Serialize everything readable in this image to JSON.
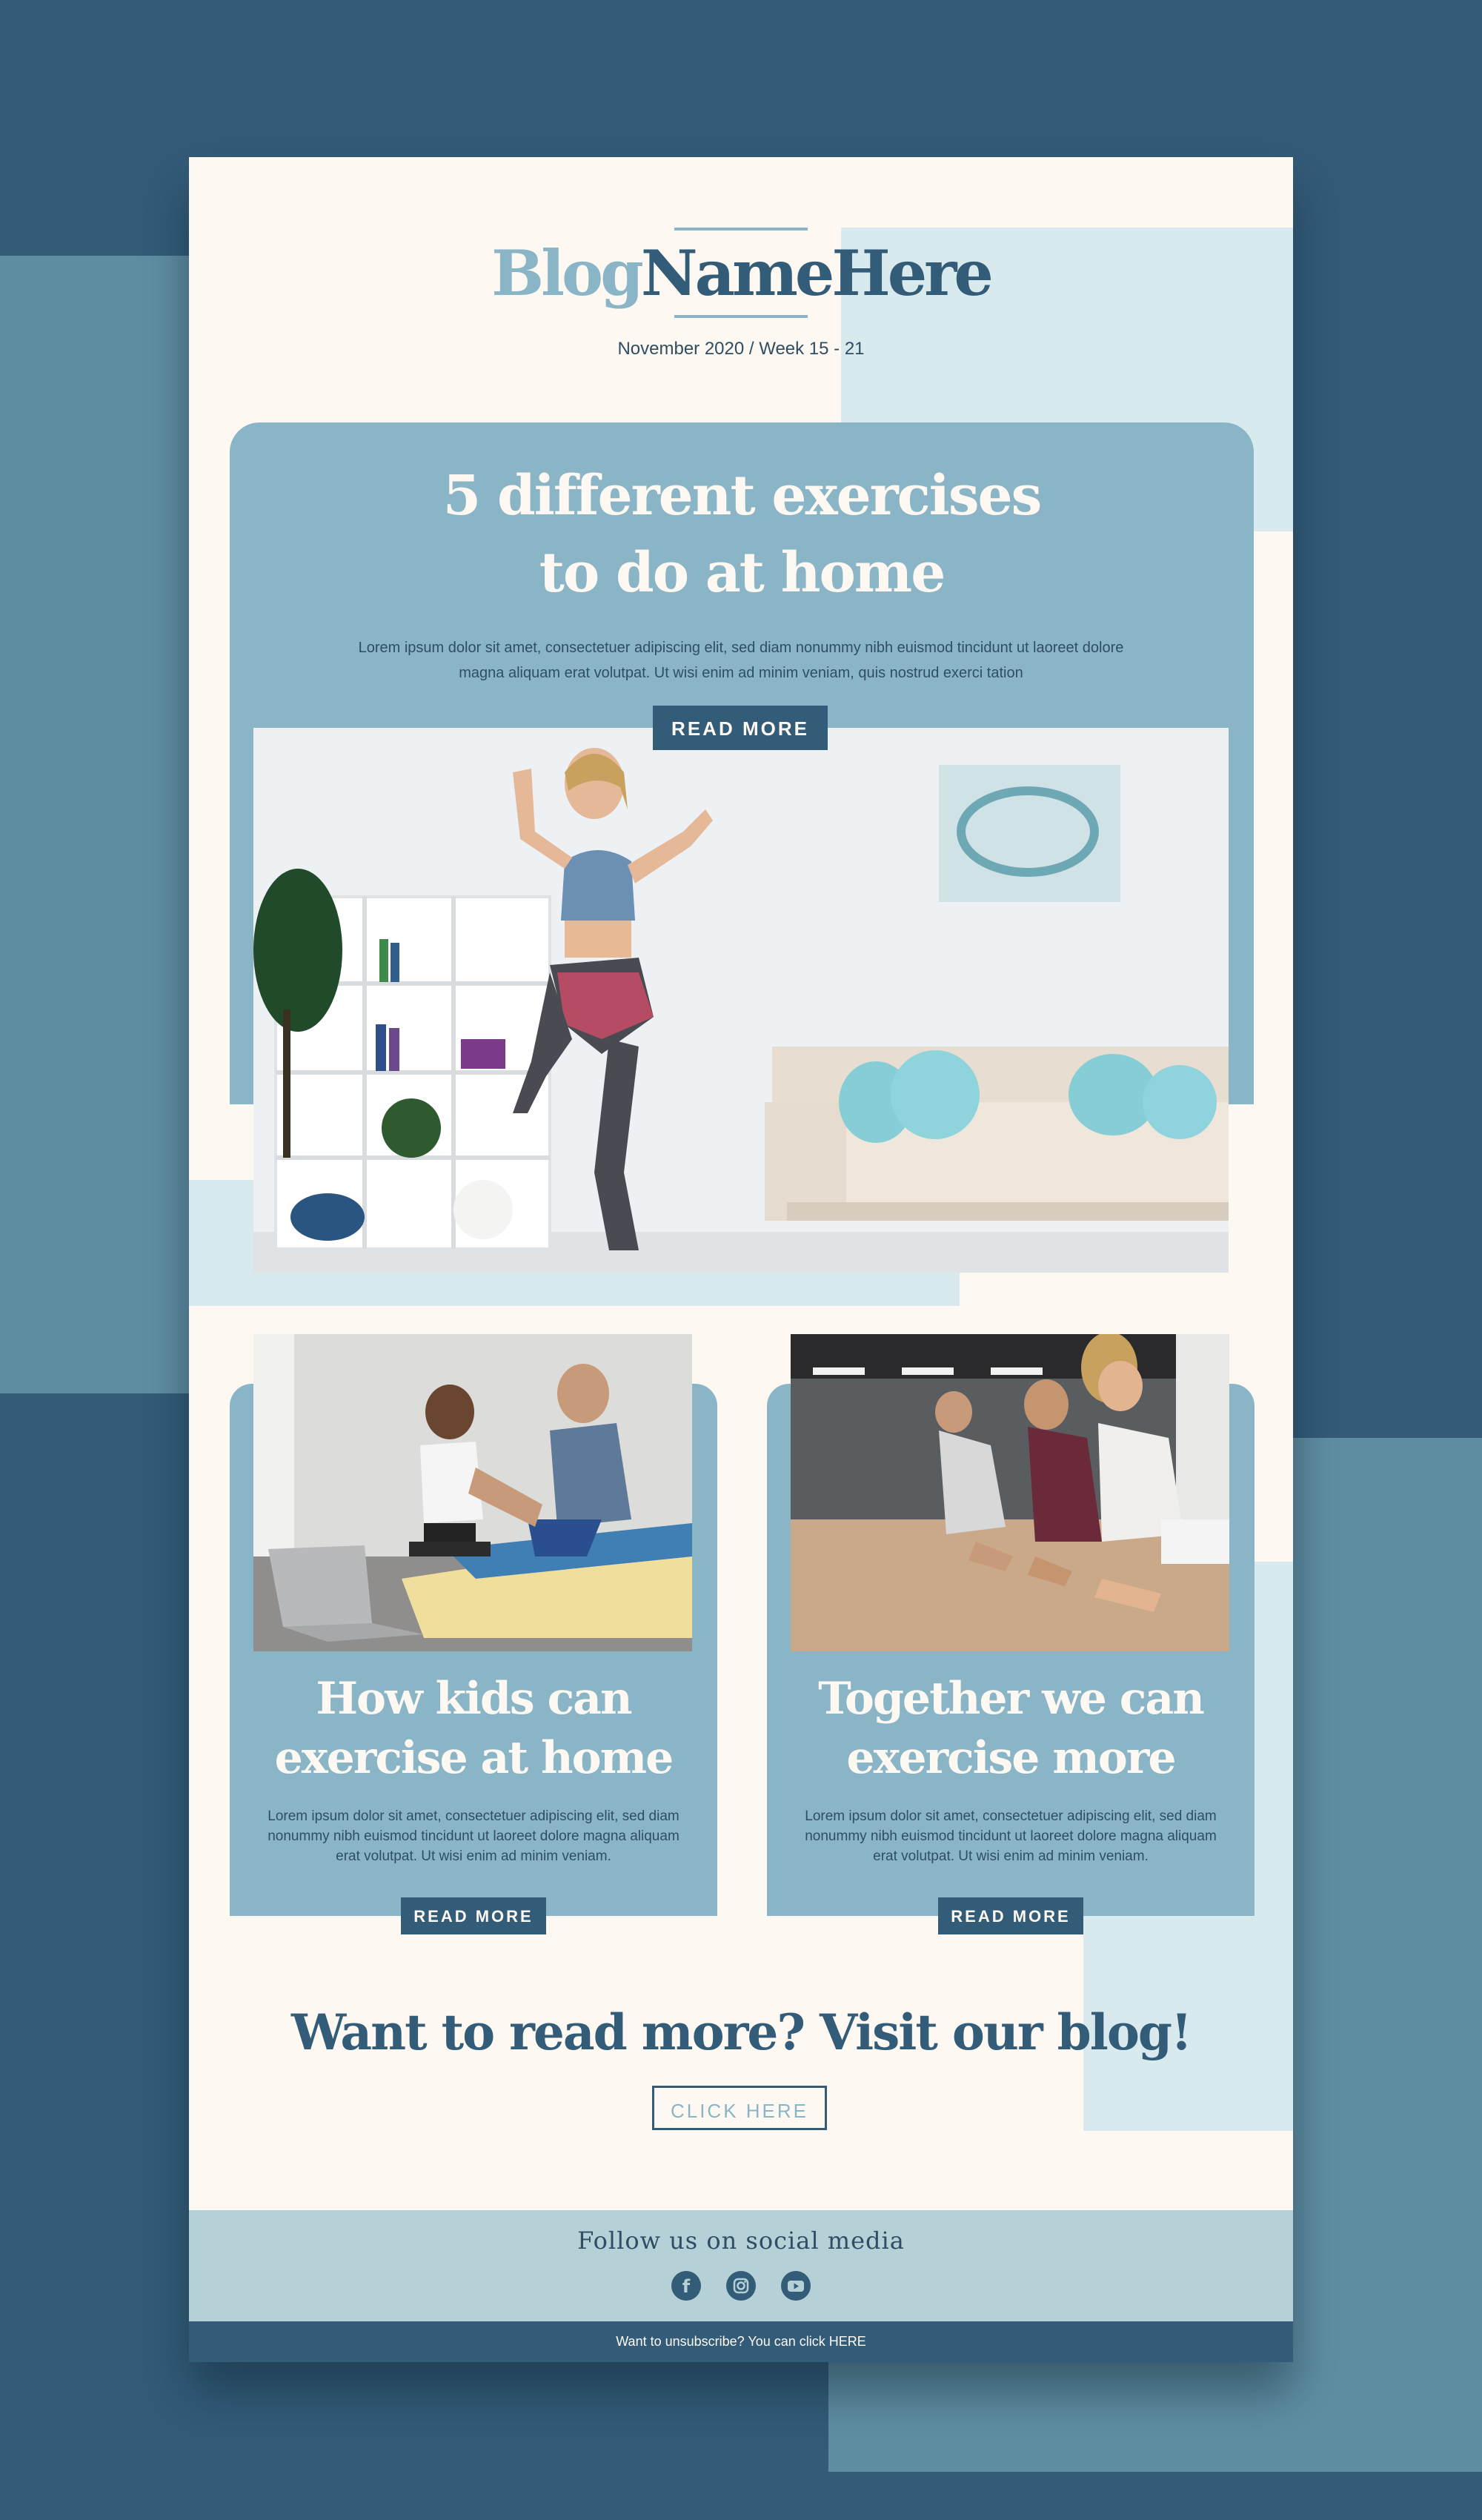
{
  "header": {
    "logo_part1": "Blog",
    "logo_part2": "NameHere",
    "date": "November 2020 / Week 15 - 21"
  },
  "hero": {
    "title_line1": "5 different exercises",
    "title_line2": "to do at home",
    "text": "Lorem ipsum dolor sit amet, consectetuer adipiscing elit, sed diam nonummy nibh euismod tincidunt ut laoreet dolore magna aliquam erat volutpat. Ut wisi enim ad minim veniam, quis nostrud exerci tation",
    "button_label": "READ MORE"
  },
  "columns": [
    {
      "title_line1": "How kids can",
      "title_line2": "exercise at home",
      "text": "Lorem ipsum dolor sit amet, consectetuer adipiscing elit, sed diam nonummy nibh euismod tincidunt ut laoreet dolore magna aliquam erat volutpat. Ut wisi enim ad minim veniam.",
      "button_label": "READ MORE"
    },
    {
      "title_line1": "Together we can",
      "title_line2": "exercise more",
      "text": "Lorem ipsum dolor sit amet, consectetuer adipiscing elit, sed diam nonummy nibh euismod tincidunt ut laoreet dolore magna aliquam erat volutpat. Ut wisi enim ad minim veniam.",
      "button_label": "READ MORE"
    }
  ],
  "cta": {
    "title": "Want to read more? Visit our blog!",
    "button_label": "CLICK HERE"
  },
  "social": {
    "title": "Follow us on social media",
    "icons": [
      "facebook-icon",
      "instagram-icon",
      "youtube-icon"
    ]
  },
  "footer": {
    "text": "Want to unsubscribe? You can click HERE"
  },
  "colors": {
    "navy": "#335c79",
    "blue": "#8ab5c7",
    "cream": "#fdf8f1",
    "light": "#d8eaee"
  }
}
